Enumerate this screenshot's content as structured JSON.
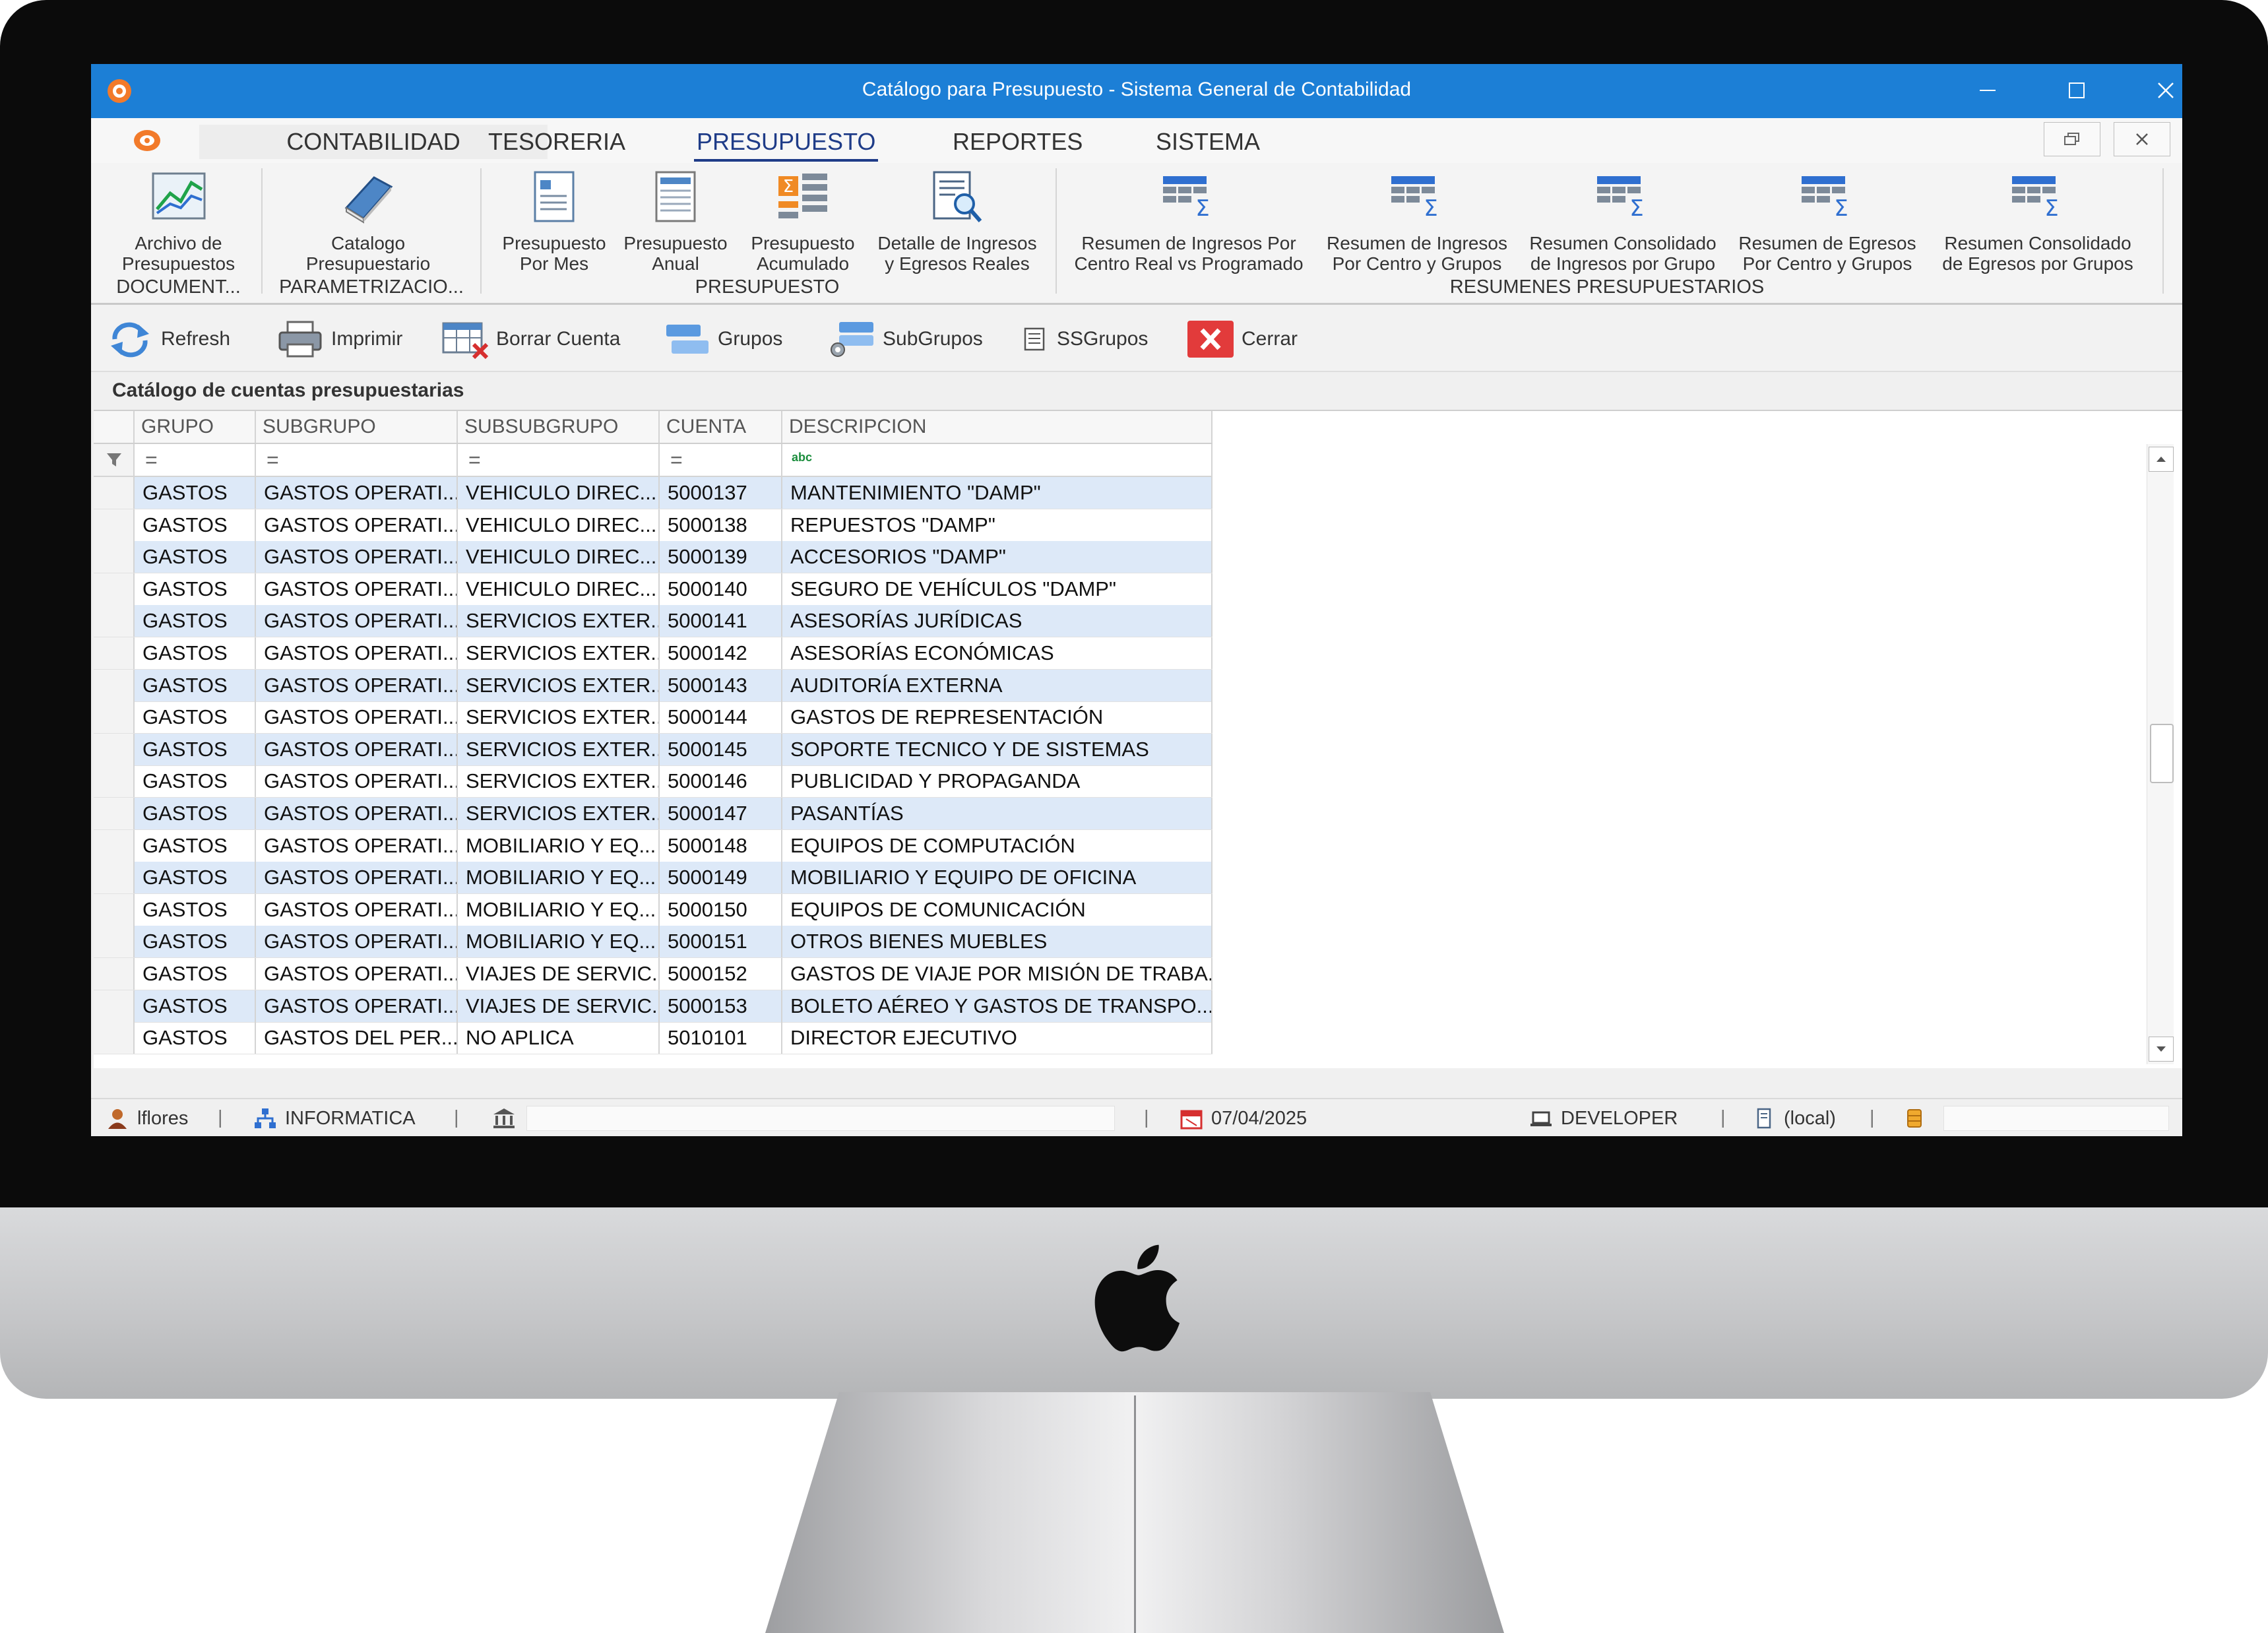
{
  "window": {
    "title": "Catálogo para Presupuesto - Sistema General de Contabilidad"
  },
  "menu_tabs": [
    {
      "label": "CONTABILIDAD"
    },
    {
      "label": "TESORERIA"
    },
    {
      "label": "PRESUPUESTO",
      "active": true
    },
    {
      "label": "REPORTES"
    },
    {
      "label": "SISTEMA"
    }
  ],
  "ribbon": {
    "buttons": [
      {
        "line1": "Archivo de",
        "line2": "Presupuestos",
        "icon": "chart-icon"
      },
      {
        "line1": "Catalogo",
        "line2": "Presupuestario",
        "icon": "book-icon"
      },
      {
        "line1": "Presupuesto",
        "line2": "Por Mes",
        "icon": "document-icon"
      },
      {
        "line1": "Presupuesto",
        "line2": "Anual",
        "icon": "report-icon"
      },
      {
        "line1": "Presupuesto",
        "line2": "Acumulado",
        "icon": "sum-icon"
      },
      {
        "line1": "Detalle de Ingresos",
        "line2": "y Egresos Reales",
        "icon": "search-report-icon"
      },
      {
        "line1": "Resumen de Ingresos Por",
        "line2": "Centro Real vs Programado",
        "icon": "table-sum-icon"
      },
      {
        "line1": "Resumen de Ingresos",
        "line2": "Por Centro y Grupos",
        "icon": "table-sum-icon"
      },
      {
        "line1": "Resumen Consolidado",
        "line2": "de Ingresos por Grupo",
        "icon": "table-sum-icon"
      },
      {
        "line1": "Resumen de Egresos",
        "line2": "Por Centro y Grupos",
        "icon": "table-sum-icon"
      },
      {
        "line1": "Resumen Consolidado",
        "line2": "de Egresos por Grupos",
        "icon": "table-sum-icon"
      }
    ],
    "groups": [
      "DOCUMENT...",
      "PARAMETRIZACIO...",
      "PRESUPUESTO",
      "RESUMENES PRESUPUESTARIOS"
    ]
  },
  "toolbar": {
    "refresh": "Refresh",
    "print": "Imprimir",
    "delete": "Borrar Cuenta",
    "groups": "Grupos",
    "subgroups": "SubGrupos",
    "ssgroups": "SSGrupos",
    "close": "Cerrar"
  },
  "panel": {
    "title": "Catálogo de cuentas presupuestarias"
  },
  "table": {
    "columns": [
      "GRUPO",
      "SUBGRUPO",
      "SUBSUBGRUPO",
      "CUENTA",
      "DESCRIPCION"
    ],
    "filter_symbols": [
      "=",
      "=",
      "=",
      "=",
      "abc"
    ],
    "rows": [
      [
        "GASTOS",
        "GASTOS OPERATI...",
        "VEHICULO DIREC...",
        "5000137",
        "MANTENIMIENTO \"DAMP\""
      ],
      [
        "GASTOS",
        "GASTOS OPERATI...",
        "VEHICULO DIREC...",
        "5000138",
        "REPUESTOS \"DAMP\""
      ],
      [
        "GASTOS",
        "GASTOS OPERATI...",
        "VEHICULO DIREC...",
        "5000139",
        "ACCESORIOS \"DAMP\""
      ],
      [
        "GASTOS",
        "GASTOS OPERATI...",
        "VEHICULO DIREC...",
        "5000140",
        "SEGURO DE VEHÍCULOS \"DAMP\""
      ],
      [
        "GASTOS",
        "GASTOS OPERATI...",
        "SERVICIOS EXTER...",
        "5000141",
        "ASESORÍAS JURÍDICAS"
      ],
      [
        "GASTOS",
        "GASTOS OPERATI...",
        "SERVICIOS EXTER...",
        "5000142",
        "ASESORÍAS ECONÓMICAS"
      ],
      [
        "GASTOS",
        "GASTOS OPERATI...",
        "SERVICIOS EXTER...",
        "5000143",
        "AUDITORÍA EXTERNA"
      ],
      [
        "GASTOS",
        "GASTOS OPERATI...",
        "SERVICIOS EXTER...",
        "5000144",
        "GASTOS DE REPRESENTACIÓN"
      ],
      [
        "GASTOS",
        "GASTOS OPERATI...",
        "SERVICIOS EXTER...",
        "5000145",
        "SOPORTE TECNICO Y DE SISTEMAS"
      ],
      [
        "GASTOS",
        "GASTOS OPERATI...",
        "SERVICIOS EXTER...",
        "5000146",
        "PUBLICIDAD Y PROPAGANDA"
      ],
      [
        "GASTOS",
        "GASTOS OPERATI...",
        "SERVICIOS EXTER...",
        "5000147",
        "PASANTÍAS"
      ],
      [
        "GASTOS",
        "GASTOS OPERATI...",
        "MOBILIARIO Y EQ...",
        "5000148",
        "EQUIPOS DE COMPUTACIÓN"
      ],
      [
        "GASTOS",
        "GASTOS OPERATI...",
        "MOBILIARIO Y EQ...",
        "5000149",
        "MOBILIARIO Y EQUIPO DE OFICINA"
      ],
      [
        "GASTOS",
        "GASTOS OPERATI...",
        "MOBILIARIO Y EQ...",
        "5000150",
        "EQUIPOS DE COMUNICACIÓN"
      ],
      [
        "GASTOS",
        "GASTOS OPERATI...",
        "MOBILIARIO Y EQ...",
        "5000151",
        "OTROS BIENES MUEBLES"
      ],
      [
        "GASTOS",
        "GASTOS OPERATI...",
        "VIAJES DE SERVIC...",
        "5000152",
        "GASTOS DE VIAJE POR MISIÓN DE TRABA..."
      ],
      [
        "GASTOS",
        "GASTOS OPERATI...",
        "VIAJES DE SERVIC...",
        "5000153",
        "BOLETO AÉREO Y GASTOS DE TRANSPO..."
      ],
      [
        "GASTOS",
        "GASTOS DEL PER...",
        "NO APLICA",
        "5010101",
        "DIRECTOR EJECUTIVO"
      ]
    ]
  },
  "status": {
    "user": "lflores",
    "department": "INFORMATICA",
    "date": "07/04/2025",
    "machine": "DEVELOPER",
    "server": "(local)"
  },
  "colors": {
    "titlebar": "#1c7fd6",
    "row_alt": "#dde9f8",
    "close_button": "#e23b3b"
  }
}
